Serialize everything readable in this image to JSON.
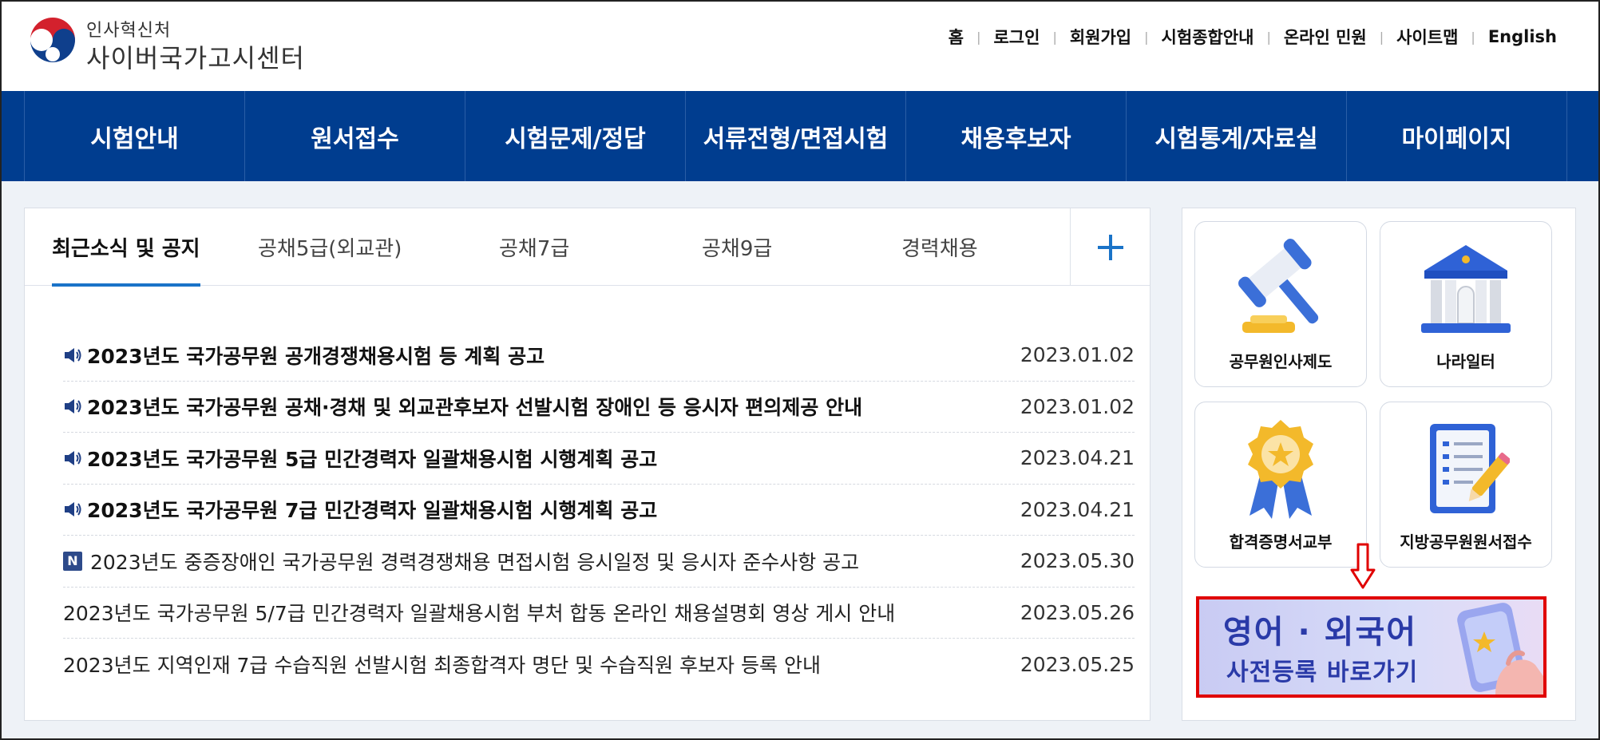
{
  "colors": {
    "brand_blue": "#003d8f",
    "accent_blue": "#1a73c8",
    "highlight_red": "#e00000"
  },
  "logo": {
    "org": "인사혁신처",
    "site": "사이버국가고시센터"
  },
  "util_nav": [
    "홈",
    "로그인",
    "회원가입",
    "시험종합안내",
    "온라인 민원",
    "사이트맵",
    "English"
  ],
  "gnb": [
    "시험안내",
    "원서접수",
    "시험문제/정답",
    "서류전형/면접시험",
    "채용후보자",
    "시험통계/자료실",
    "마이페이지"
  ],
  "tabs": [
    "최근소식 및 공지",
    "공채5급(외교관)",
    "공채7급",
    "공채9급",
    "경력채용"
  ],
  "notices": [
    {
      "title": "2023년도 국가공무원 공개경쟁채용시험 등 계획 공고",
      "date": "2023.01.02",
      "icon": "speaker-icon",
      "bold": true
    },
    {
      "title": "2023년도 국가공무원 공채·경채 및 외교관후보자 선발시험 장애인 등 응시자 편의제공 안내",
      "date": "2023.01.02",
      "icon": "speaker-icon",
      "bold": true
    },
    {
      "title": "2023년도 국가공무원 5급 민간경력자 일괄채용시험 시행계획 공고",
      "date": "2023.04.21",
      "icon": "speaker-icon",
      "bold": true
    },
    {
      "title": "2023년도 국가공무원 7급 민간경력자 일괄채용시험 시행계획 공고",
      "date": "2023.04.21",
      "icon": "speaker-icon",
      "bold": true
    },
    {
      "title": "2023년도 중증장애인 국가공무원 경력경쟁채용 면접시험 응시일정 및 응시자 준수사항 공고",
      "date": "2023.05.30",
      "icon": "new-badge",
      "bold": false
    },
    {
      "title": "2023년도 국가공무원 5/7급 민간경력자 일괄채용시험 부처 합동 온라인 채용설명회 영상 게시 안내",
      "date": "2023.05.26",
      "icon": "",
      "bold": false
    },
    {
      "title": "2023년도 지역인재 7급 수습직원 선발시험 최종합격자 명단 및 수습직원 후보자 등록 안내",
      "date": "2023.05.25",
      "icon": "",
      "bold": false
    }
  ],
  "new_badge": "N",
  "quick_links": [
    {
      "label": "공무원인사제도",
      "icon": "gavel-icon"
    },
    {
      "label": "나라일터",
      "icon": "government-building-icon"
    },
    {
      "label": "합격증명서교부",
      "icon": "award-medal-icon"
    },
    {
      "label": "지방공무원원서접수",
      "icon": "document-pencil-icon"
    }
  ],
  "banner": {
    "line1": "영어 · 외국어",
    "line2": "사전등록 바로가기"
  }
}
